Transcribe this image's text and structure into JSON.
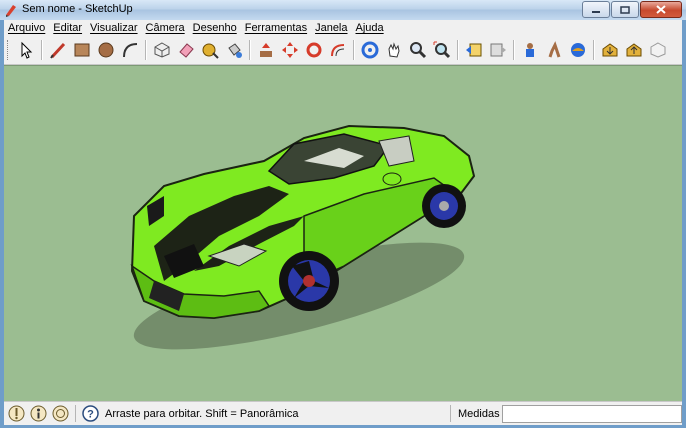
{
  "window": {
    "title": "Sem nome - SketchUp"
  },
  "menu": [
    {
      "label": "Arquivo"
    },
    {
      "label": "Editar"
    },
    {
      "label": "Visualizar"
    },
    {
      "label": "Câmera"
    },
    {
      "label": "Desenho"
    },
    {
      "label": "Ferramentas"
    },
    {
      "label": "Janela"
    },
    {
      "label": "Ajuda"
    }
  ],
  "toolbar": {
    "tools": [
      "select-icon",
      "line-pencil-icon",
      "rectangle-icon",
      "circle-icon",
      "arc-icon",
      "make-component-icon",
      "eraser-icon",
      "tape-measure-icon",
      "paint-bucket-icon",
      "push-pull-icon",
      "move-icon",
      "rotate-icon",
      "offset-icon",
      "orbit-icon",
      "pan-icon",
      "zoom-icon",
      "zoom-extents-icon",
      "previous-view-icon",
      "next-view-icon",
      "position-camera-icon",
      "walk-icon",
      "look-around-icon",
      "get-models-icon",
      "share-model-icon",
      "share-component-icon"
    ]
  },
  "status": {
    "text": "Arraste para orbitar. Shift = Panorâmica",
    "measures_label": "Medidas",
    "measures_value": ""
  },
  "colors": {
    "viewport": "#9bbd91",
    "car_body": "#7fea21",
    "stripe": "#1d2316"
  }
}
